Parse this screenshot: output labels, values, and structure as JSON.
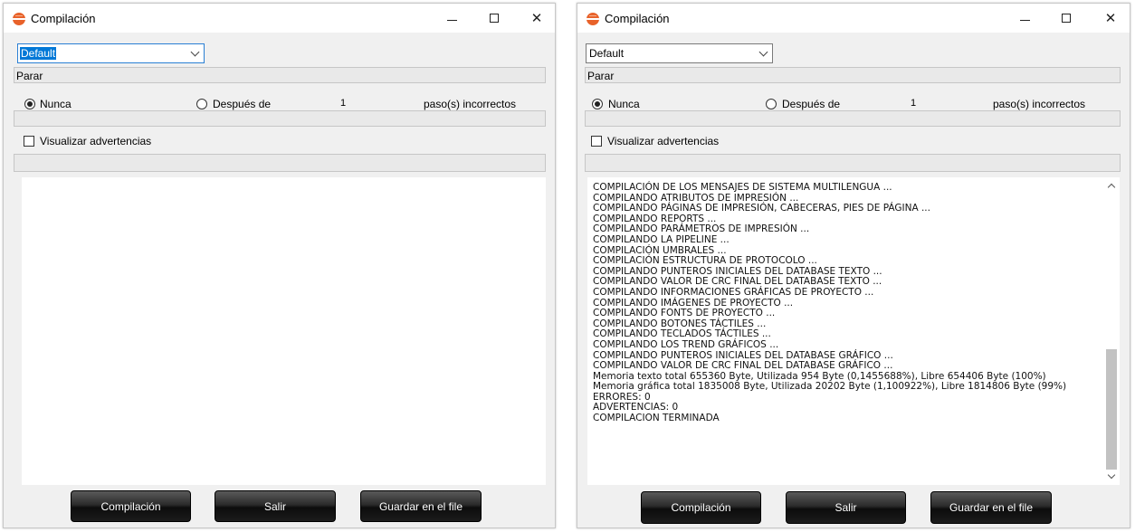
{
  "window_title": "Compilación",
  "select": {
    "value": "Default"
  },
  "stop_label": "Parar",
  "radio_never": "Nunca",
  "radio_after": "Después de",
  "step_count": "1",
  "step_suffix": "paso(s) incorrectos",
  "show_warnings": "Visualizar advertencias",
  "buttons": {
    "compile": "Compilación",
    "exit": "Salir",
    "save": "Guardar en el file"
  },
  "icons": {
    "app": "compiler-app-icon",
    "minimize": "minimize-icon",
    "maximize": "maximize-icon",
    "close": "close-icon",
    "dropdown": "chevron-down-icon",
    "scroll_up": "chevron-up-icon",
    "scroll_down": "chevron-down-icon"
  },
  "accent_color": "#e8622a",
  "selection_color": "#0078d7",
  "left_output": [],
  "right_output": [
    "COMPILACIÓN DE LOS MENSAJES DE SISTEMA MULTILENGUA ...",
    "COMPILANDO ATRIBUTOS DE IMPRESIÓN ...",
    "COMPILANDO PÁGINAS DE IMPRESIÓN, CABECERAS, PIES DE PÁGINA ...",
    "COMPILANDO REPORTS ...",
    "COMPILANDO PARÁMETROS DE IMPRESIÓN ...",
    "COMPILANDO LA PIPELINE ...",
    "COMPILACIÓN UMBRALES ...",
    "COMPILACIÓN ESTRUCTURA DE PROTOCOLO ...",
    "COMPILANDO PUNTEROS INICIALES DEL DATABASE TEXTO ...",
    "COMPILANDO VALOR DE CRC FINAL DEL DATABASE TEXTO ...",
    "COMPILANDO INFORMACIONES GRÁFICAS DE PROYECTO ...",
    "COMPILANDO IMÁGENES DE PROYECTO ...",
    "COMPILANDO FONTS DE PROYECTO ...",
    "COMPILANDO BOTONES TÁCTILES ...",
    "COMPILANDO TECLADOS TÁCTILES ...",
    "COMPILANDO LOS TREND GRÁFICOS ...",
    "COMPILANDO PUNTEROS INICIALES DEL DATABASE GRÁFICO ...",
    "COMPILANDO VALOR DE CRC FINAL DEL DATABASE GRÁFICO ...",
    "Memoria texto total 655360 Byte, Utilizada 954 Byte (0,1455688%), Libre 654406 Byte (100%)",
    "Memoria gráfica total 1835008 Byte, Utilizada 20202 Byte (1,100922%), Libre 1814806 Byte (99%)",
    "ERRORES: 0",
    "ADVERTENCIAS: 0",
    "COMPILACION TERMINADA"
  ]
}
